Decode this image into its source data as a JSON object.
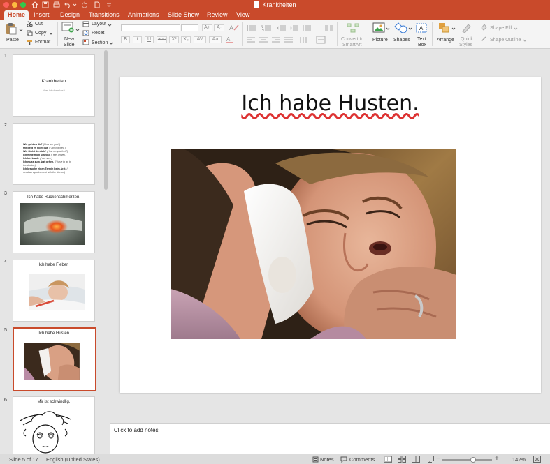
{
  "window": {
    "title": "Krankheiten"
  },
  "tabs": [
    {
      "label": "Home",
      "active": true
    },
    {
      "label": "Insert"
    },
    {
      "label": "Design"
    },
    {
      "label": "Transitions"
    },
    {
      "label": "Animations"
    },
    {
      "label": "Slide Show"
    },
    {
      "label": "Review"
    },
    {
      "label": "View"
    }
  ],
  "ribbon": {
    "paste": "Paste",
    "cut": "Cut",
    "copy": "Copy",
    "format": "Format",
    "new_slide": [
      "New",
      "Slide"
    ],
    "layout": "Layout",
    "reset": "Reset",
    "section": "Section",
    "convert": [
      "Convert to",
      "SmartArt"
    ],
    "picture": "Picture",
    "shapes": "Shapes",
    "text_box": [
      "Text",
      "Box"
    ],
    "arrange": "Arrange",
    "quick_styles": [
      "Quick",
      "Styles"
    ],
    "shape_fill": "Shape Fill",
    "shape_outline": "Shape Outline",
    "font_buttons": [
      "B",
      "I",
      "U",
      "abc",
      "X²",
      "X₂",
      "AV",
      "Aa"
    ],
    "size_buttons": [
      "A+",
      "A-"
    ]
  },
  "thumbnails": [
    {
      "num": "1",
      "title": "Krankheiten",
      "subtitle": "Was ist denn los?"
    },
    {
      "num": "2",
      "lines": [
        {
          "b": "Wie geht es dir?",
          "i": "(How are you?)"
        },
        {
          "b": "Mir geht es nicht gut.",
          "i": "(I am not well.)"
        },
        {
          "b": "Wie fühlst du dich?",
          "i": "(How do you feel?)"
        },
        {
          "b": "Ich fühle mich unwohl.",
          "i": "(I feel unwell.)"
        },
        {
          "b": "Ich bin krank.",
          "i": "(I am sick.)"
        },
        {
          "b": "Ich muss zum Arzt gehen.",
          "i": "(I have to go to"
        },
        {
          "b": "",
          "i": "the doctor.)"
        },
        {
          "b": "Ich brauche einen Termin beim Arzt.",
          "i": "(I"
        },
        {
          "b": "",
          "i": "need an appointment with the doctor.)"
        }
      ]
    },
    {
      "num": "3",
      "title": "Ich habe Rückenschmerzen."
    },
    {
      "num": "4",
      "title": "Ich habe Fieber."
    },
    {
      "num": "5",
      "title": "Ich habe Husten.",
      "selected": true
    },
    {
      "num": "6",
      "title": "Mir ist schwindlig."
    }
  ],
  "slide": {
    "title": "Ich habe Husten."
  },
  "notes": {
    "placeholder": "Click to add notes"
  },
  "status": {
    "slide_counter": "Slide 5 of 17",
    "language": "English (United States)",
    "notes": "Notes",
    "comments": "Comments",
    "zoom": "142%",
    "zoom_level": 0.62
  },
  "colors": {
    "accent": "#c94a2b",
    "selection": "#c94a2b"
  }
}
